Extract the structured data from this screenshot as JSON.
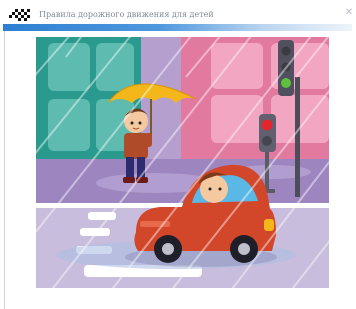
{
  "window": {
    "title": "Правила дорожного движения для детей",
    "close_icon": "close-x-icon",
    "app_icon": "checkered-flag-icon",
    "accent_color": "#2e7fd2"
  },
  "illustration": {
    "subject": "rainy-street-crossing",
    "colors": {
      "building_left": "#2a9a8e",
      "building_right": "#e27aa0",
      "street_wall": "#a78fc6",
      "car_body": "#d2462a",
      "umbrella": "#f4b71a",
      "traffic_light_red": "#e3262b",
      "traffic_light_green": "#5fc13c"
    }
  }
}
